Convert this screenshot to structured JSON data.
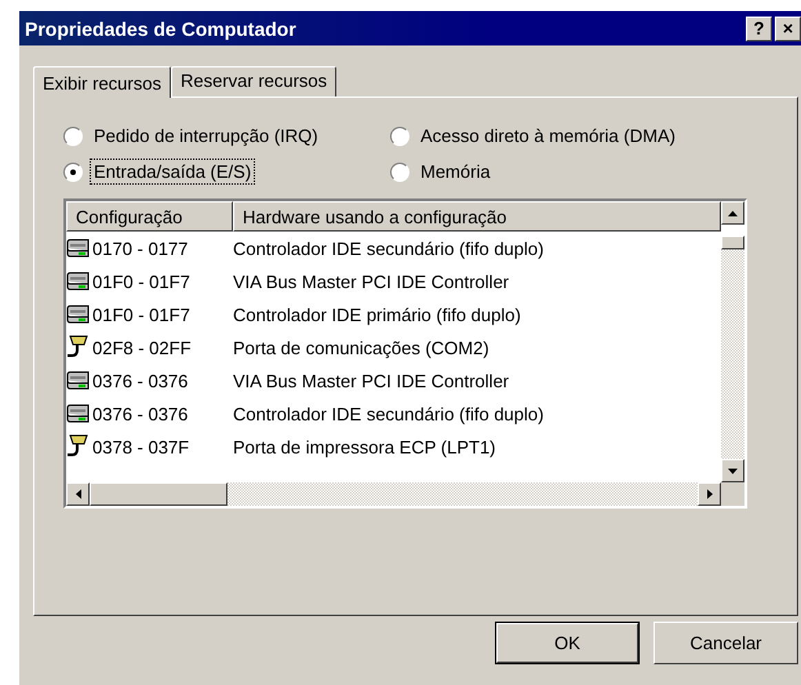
{
  "window": {
    "title": "Propriedades de Computador",
    "help_button": "?",
    "close_button": "×"
  },
  "tabs": [
    {
      "label": "Exibir recursos",
      "selected": true
    },
    {
      "label": "Reservar recursos",
      "selected": false
    }
  ],
  "options": [
    {
      "label": "Pedido de interrupção (IRQ)",
      "selected": false,
      "focused": false
    },
    {
      "label": "Acesso direto à memória (DMA)",
      "selected": false,
      "focused": false
    },
    {
      "label": "Entrada/saída (E/S)",
      "selected": true,
      "focused": true
    },
    {
      "label": "Memória",
      "selected": false,
      "focused": false
    }
  ],
  "table": {
    "columns": [
      "Configuração",
      "Hardware usando a configuração"
    ],
    "rows": [
      {
        "kind": "drive",
        "range": "0170 - 0177",
        "hardware": "Controlador IDE secundário (fifo duplo)"
      },
      {
        "kind": "drive",
        "range": "01F0 - 01F7",
        "hardware": "VIA Bus Master PCI IDE Controller"
      },
      {
        "kind": "drive",
        "range": "01F0 - 01F7",
        "hardware": "Controlador IDE primário (fifo duplo)"
      },
      {
        "kind": "port",
        "range": "02F8 - 02FF",
        "hardware": "Porta de comunicações (COM2)"
      },
      {
        "kind": "drive",
        "range": "0376 - 0376",
        "hardware": "VIA Bus Master PCI IDE Controller"
      },
      {
        "kind": "drive",
        "range": "0376 - 0376",
        "hardware": "Controlador IDE secundário (fifo duplo)"
      },
      {
        "kind": "port",
        "range": "0378 - 037F",
        "hardware": "Porta de impressora ECP (LPT1)"
      }
    ]
  },
  "buttons": [
    {
      "label": "OK",
      "default": true
    },
    {
      "label": "Cancelar",
      "default": false
    }
  ]
}
